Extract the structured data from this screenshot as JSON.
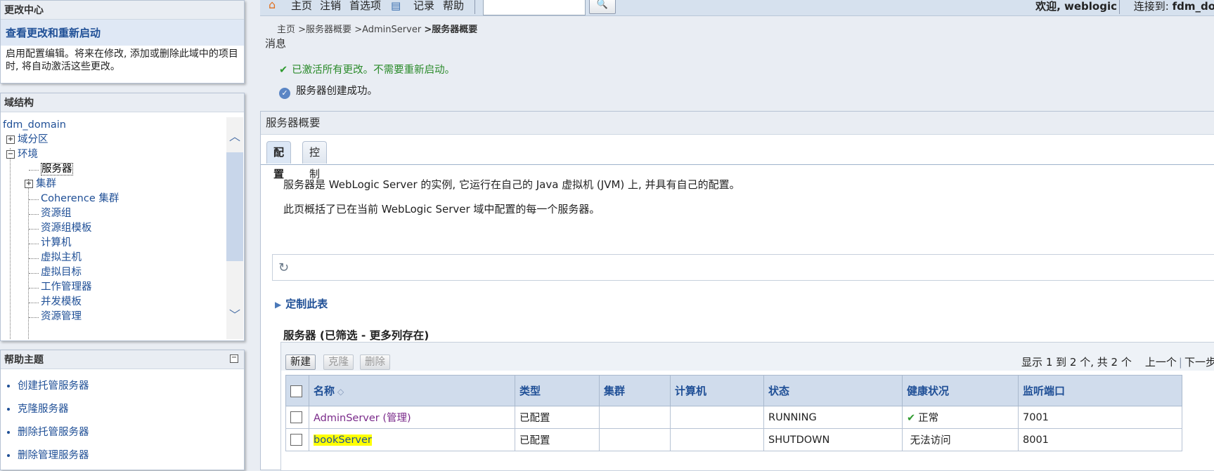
{
  "change_center": {
    "title": "更改中心",
    "link": "查看更改和重新启动",
    "description": "启用配置编辑。将来在修改, 添加或删除此域中的项目时, 将自动激活这些更改。"
  },
  "domain_structure": {
    "title": "域结构",
    "root": "fdm_domain",
    "items": [
      "域分区",
      "环境",
      "服务器",
      "集群",
      "Coherence 集群",
      "资源组",
      "资源组模板",
      "计算机",
      "虚拟主机",
      "虚拟目标",
      "工作管理器",
      "并发模板",
      "资源管理"
    ]
  },
  "help_topics": {
    "title": "帮助主题",
    "items": [
      "创建托管服务器",
      "克隆服务器",
      "删除托管服务器",
      "删除管理服务器"
    ]
  },
  "topbar": {
    "home": "主页",
    "logout": "注销",
    "preferences": "首选项",
    "record": "记录",
    "help": "帮助",
    "search_value": "",
    "welcome": "欢迎, weblogic",
    "connected_label": "连接到:",
    "connected_domain": "fdm_do"
  },
  "breadcrumb": {
    "home": "主页",
    "item1": ">服务器概要",
    "item2": ">AdminServer",
    "current": ">服务器概要"
  },
  "messages": {
    "title": "消息",
    "success": "已激活所有更改。不需要重新启动。",
    "info": "服务器创建成功。"
  },
  "summary": {
    "title": "服务器概要",
    "tabs": [
      "配置",
      "控制"
    ],
    "intro1": "服务器是 WebLogic Server 的实例, 它运行在自己的 Java 虚拟机 (JVM) 上, 并具有自己的配置。",
    "intro2": "此页概括了已在当前 WebLogic Server 域中配置的每一个服务器。",
    "customize": "定制此表",
    "table_title": "服务器 (已筛选 - 更多列存在)",
    "buttons": {
      "new": "新建",
      "clone": "克隆",
      "delete": "删除"
    },
    "pager": {
      "info": "显示 1 到 2 个, 共 2 个",
      "prev": "上一个",
      "next": "下一步"
    },
    "columns": [
      "名称",
      "类型",
      "集群",
      "计算机",
      "状态",
      "健康状况",
      "监听端口"
    ],
    "rows": [
      {
        "name": "AdminServer (管理)",
        "type": "已配置",
        "cluster": "",
        "machine": "",
        "state": "RUNNING",
        "health": "正常",
        "port": "7001"
      },
      {
        "name": "bookServer",
        "type": "已配置",
        "cluster": "",
        "machine": "",
        "state": "SHUTDOWN",
        "health": "无法访问",
        "port": "8001"
      }
    ]
  },
  "colors": {
    "link": "#1f4f96",
    "success": "#2a8a2a",
    "highlight": "#ffff00",
    "header_bg": "#d0dcec"
  }
}
